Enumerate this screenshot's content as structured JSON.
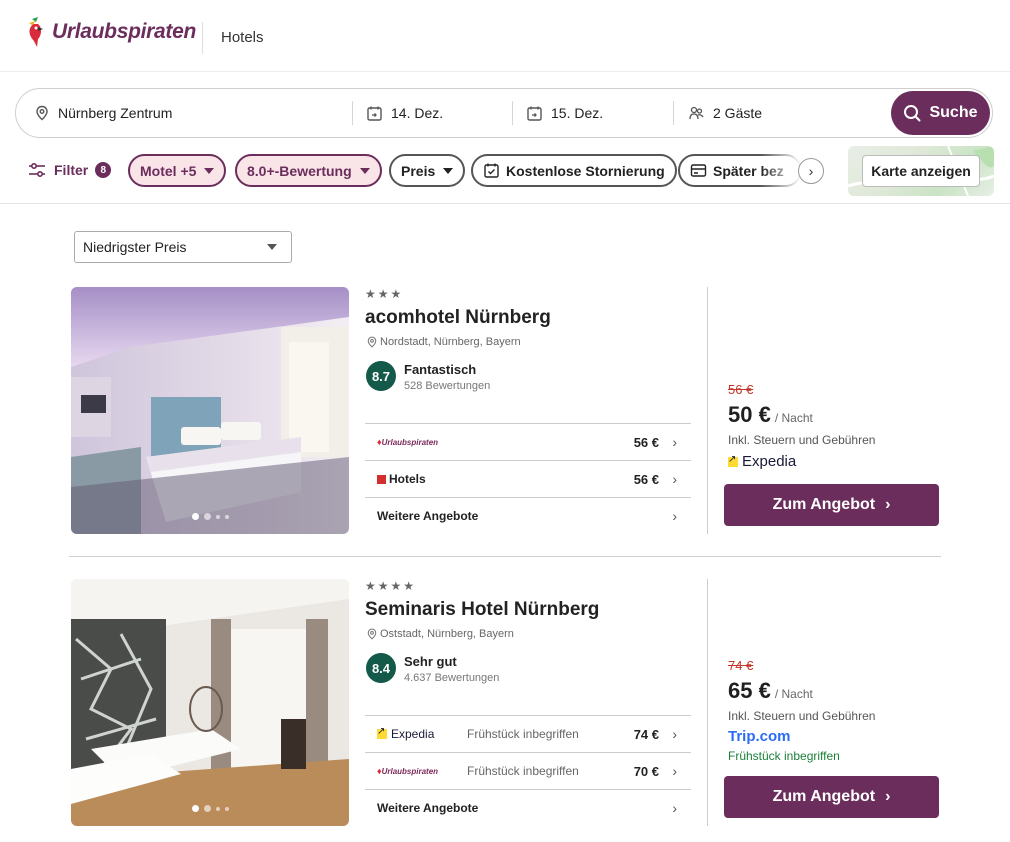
{
  "brand": {
    "name": "Urlaubspiraten",
    "color": "#6b2d5c"
  },
  "header": {
    "nav_link": "Hotels"
  },
  "search": {
    "destination": "Nürnberg Zentrum",
    "checkin": "14. Dez.",
    "checkout": "15. Dez.",
    "guests": "2 Gäste",
    "button_label": "Suche"
  },
  "filters": {
    "label": "Filter",
    "count": "8",
    "chips": [
      {
        "label": "Motel +5",
        "active": true
      },
      {
        "label": "8.0+-Bewertung",
        "active": true
      },
      {
        "label": "Preis",
        "active": false
      },
      {
        "label": "Kostenlose Stornierung",
        "active": false
      },
      {
        "label": "Später bez",
        "active": false
      }
    ],
    "map_button": "Karte anzeigen"
  },
  "sort": {
    "selected": "Niedrigster Preis"
  },
  "hotels": [
    {
      "stars": "★★★",
      "name": "acomhotel Nürnberg",
      "location": "Nordstadt, Nürnberg, Bayern",
      "score": "8.7",
      "score_label": "Fantastisch",
      "review_count": "528 Bewertungen",
      "offers": [
        {
          "provider": "Urlaubspiraten",
          "extra": "",
          "price": "56 €"
        },
        {
          "provider": "Hotels",
          "extra": "",
          "price": "56 €"
        }
      ],
      "more_offers": "Weitere Angebote",
      "old_price": "56 €",
      "price": "50 €",
      "per_night": "/ Nacht",
      "tax_note": "Inkl. Steuern und Gebühren",
      "best_provider": "Expedia",
      "breakfast": "",
      "cta": "Zum Angebot"
    },
    {
      "stars": "★★★★",
      "name": "Seminaris Hotel Nürnberg",
      "location": "Oststadt, Nürnberg, Bayern",
      "score": "8.4",
      "score_label": "Sehr gut",
      "review_count": "4.637 Bewertungen",
      "offers": [
        {
          "provider": "Expedia",
          "extra": "Frühstück inbegriffen",
          "price": "74 €"
        },
        {
          "provider": "Urlaubspiraten",
          "extra": "Frühstück inbegriffen",
          "price": "70 €"
        }
      ],
      "more_offers": "Weitere Angebote",
      "old_price": "74 €",
      "price": "65 €",
      "per_night": "/ Nacht",
      "tax_note": "Inkl. Steuern und Gebühren",
      "best_provider": "Trip.com",
      "breakfast": "Frühstück inbegriffen",
      "cta": "Zum Angebot"
    }
  ]
}
